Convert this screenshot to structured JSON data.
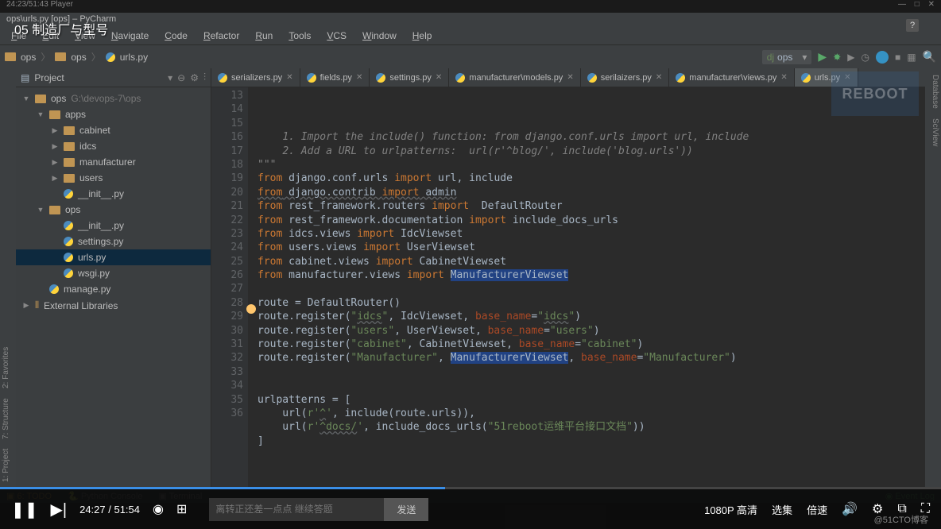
{
  "player": {
    "top_time": "24:23/51:43 Player",
    "subtitle": "05 制造厂与型号",
    "time": "24:27 / 51:54",
    "quality": "1080P 高清",
    "select": "选集",
    "speed": "倍速",
    "danmu_placeholder": "离转正还差一点点 继续答题",
    "send": "发送",
    "author": "@51CTO博客"
  },
  "window": {
    "title": "ops\\urls.py [ops] – PyCharm",
    "help": "?"
  },
  "menu": [
    "File",
    "Edit",
    "View",
    "Navigate",
    "Code",
    "Refactor",
    "Run",
    "Tools",
    "VCS",
    "Window",
    "Help"
  ],
  "breadcrumb": {
    "p1": "ops",
    "p2": "ops",
    "p3": "urls.py"
  },
  "run_config": "ops",
  "project_panel": {
    "title": "Project"
  },
  "tree": [
    {
      "depth": 0,
      "arrow": "down",
      "icon": "folder",
      "label": "ops",
      "hint": "G:\\devops-7\\ops"
    },
    {
      "depth": 1,
      "arrow": "down",
      "icon": "folder",
      "label": "apps"
    },
    {
      "depth": 2,
      "arrow": "right",
      "icon": "folder",
      "label": "cabinet"
    },
    {
      "depth": 2,
      "arrow": "right",
      "icon": "folder",
      "label": "idcs"
    },
    {
      "depth": 2,
      "arrow": "right",
      "icon": "folder",
      "label": "manufacturer"
    },
    {
      "depth": 2,
      "arrow": "right",
      "icon": "folder",
      "label": "users"
    },
    {
      "depth": 2,
      "arrow": "",
      "icon": "py",
      "label": "__init__.py"
    },
    {
      "depth": 1,
      "arrow": "down",
      "icon": "folder",
      "label": "ops"
    },
    {
      "depth": 2,
      "arrow": "",
      "icon": "py",
      "label": "__init__.py"
    },
    {
      "depth": 2,
      "arrow": "",
      "icon": "py",
      "label": "settings.py"
    },
    {
      "depth": 2,
      "arrow": "",
      "icon": "py",
      "label": "urls.py",
      "selected": true
    },
    {
      "depth": 2,
      "arrow": "",
      "icon": "py",
      "label": "wsgi.py"
    },
    {
      "depth": 1,
      "arrow": "",
      "icon": "py",
      "label": "manage.py"
    },
    {
      "depth": 0,
      "arrow": "right",
      "icon": "lib",
      "label": "External Libraries"
    }
  ],
  "tabs": [
    {
      "label": "serializers.py",
      "icon": "py"
    },
    {
      "label": "fields.py",
      "icon": "py"
    },
    {
      "label": "settings.py",
      "icon": "py"
    },
    {
      "label": "manufacturer\\models.py",
      "icon": "py"
    },
    {
      "label": "serilaizers.py",
      "icon": "py"
    },
    {
      "label": "manufacturer\\views.py",
      "icon": "py"
    },
    {
      "label": "urls.py",
      "icon": "py",
      "active": true
    }
  ],
  "code_start_line": 13,
  "code_lines": [
    {
      "html": "    <span class='com'>1. Import the include() function: from django.conf.urls import url, include</span>"
    },
    {
      "html": "    <span class='com'>2. Add a URL to urlpatterns:  url(r'^blog/', include('blog.urls'))</span>"
    },
    {
      "html": "<span class='com'>\"\"\"</span>"
    },
    {
      "html": "<span class='kw'>from</span> django.conf.urls <span class='kw'>import</span> url, include"
    },
    {
      "html": "<span class='kw udl'>from</span><span class='udl'> django.contrib </span><span class='kw udl'>import</span><span class='udl'> admin</span>"
    },
    {
      "html": "<span class='kw'>from</span> rest_framework.routers <span class='kw'>import</span>  DefaultRouter"
    },
    {
      "html": "<span class='kw'>from</span> rest_framework.documentation <span class='kw'>import</span> include_docs_urls"
    },
    {
      "html": "<span class='kw'>from</span> idcs.views <span class='kw'>import</span> IdcViewset"
    },
    {
      "html": "<span class='kw'>from</span> users.views <span class='kw'>import</span> UserViewset"
    },
    {
      "html": "<span class='kw'>from</span> cabinet.views <span class='kw'>import</span> CabinetViewset"
    },
    {
      "html": "<span class='kw'>from</span> manufacturer.views <span class='kw'>import</span> <span class='hl'>ManufacturerViewset</span>"
    },
    {
      "html": ""
    },
    {
      "html": "route = DefaultRouter()"
    },
    {
      "html": "route.register(<span class='str'>\"<span class='udl'>idcs</span>\"</span>, IdcViewset, <span class='param'>base_name</span>=<span class='str'>\"<span class='udl'>idcs</span>\"</span>)"
    },
    {
      "html": "route.register(<span class='str'>\"users\"</span>, UserViewset, <span class='param'>base_name</span>=<span class='str'>\"users\"</span>)"
    },
    {
      "html": "route.register(<span class='str'>\"cabinet\"</span>, CabinetViewset, <span class='param'>base_name</span>=<span class='str'>\"cabinet\"</span>)"
    },
    {
      "html": "route.register(<span class='str'>\"Manufacturer\"</span>, <span class='hl'>ManufacturerViewset</span>, <span class='param'>base_name</span>=<span class='str'>\"Manufacturer\"</span>)"
    },
    {
      "html": ""
    },
    {
      "html": ""
    },
    {
      "html": "urlpatterns = ["
    },
    {
      "html": "    url(<span class='str'>r'<span class='udl'>^</span>'</span>, include(route.urls)),"
    },
    {
      "html": "    url(<span class='str'>r'<span class='udl'>^docs/</span>'</span>, include_docs_urls(<span class='str'>\"51reboot运维平台接口文档\"</span>))"
    },
    {
      "html": "]"
    },
    {
      "html": ""
    }
  ],
  "bottom": {
    "todo": "6: TODO",
    "console": "Python Console",
    "terminal": "Terminal",
    "event": "Event Log"
  },
  "right_rail": [
    "Database",
    "SciView"
  ],
  "left_rail": [
    "1: Project",
    "7: Structure",
    "2: Favorites"
  ]
}
